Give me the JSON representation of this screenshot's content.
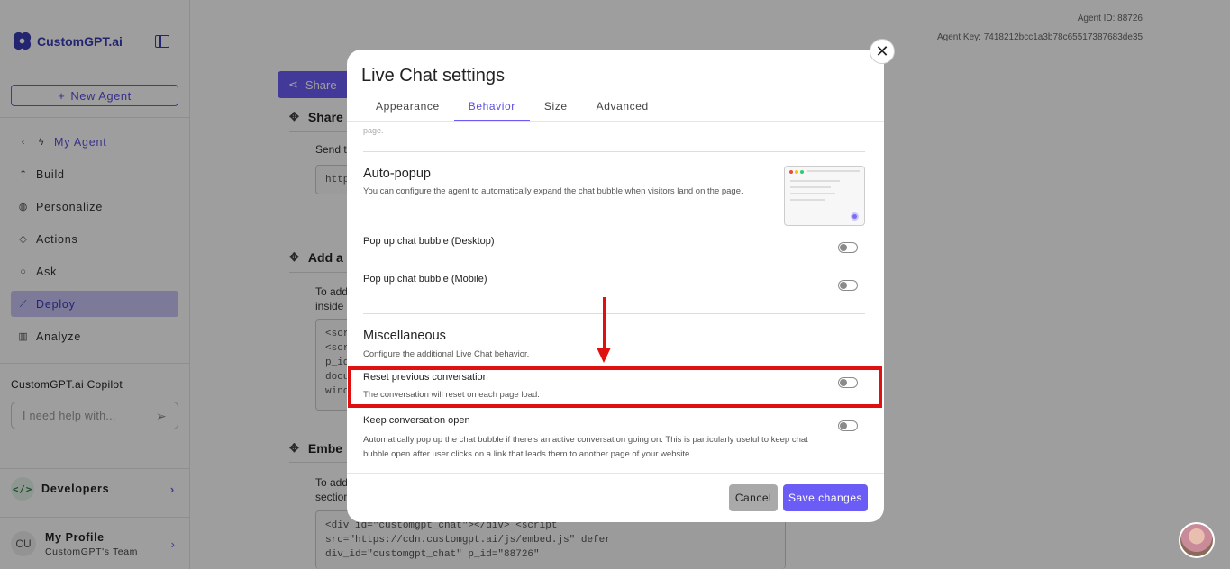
{
  "sidebar": {
    "logo_text": "CustomGPT.ai",
    "new_agent_label": "New Agent",
    "back_label": "My Agent",
    "items": [
      {
        "label": "Build",
        "icon": "build-icon"
      },
      {
        "label": "Personalize",
        "icon": "palette-icon"
      },
      {
        "label": "Actions",
        "icon": "actions-icon"
      },
      {
        "label": "Ask",
        "icon": "chat-icon"
      },
      {
        "label": "Deploy",
        "icon": "rocket-icon",
        "active": true
      },
      {
        "label": "Analyze",
        "icon": "chart-icon"
      }
    ],
    "copilot_title": "CustomGPT.ai Copilot",
    "copilot_placeholder": "I need help with...",
    "developers_label": "Developers",
    "profile_initials": "CU",
    "profile_name": "My Profile",
    "profile_team": "CustomGPT's Team"
  },
  "main": {
    "agent_id": "Agent ID: 88726",
    "agent_key": "Agent Key: 7418212bcc1a3b78c65517387683de35",
    "share_button": "Share",
    "section1_title": "Share",
    "section1_text": "Send t",
    "section1_box": "http",
    "section2_title": "Add a",
    "section2_text_1": "To add",
    "section2_text_2": "inside",
    "section2_box_lines": [
      "<scri",
      "<scri",
      "p_id",
      "docu",
      "wind"
    ],
    "section3_title": "Embe",
    "section3_text_1": "To add",
    "section3_text_2": "section",
    "section3_box_lines": [
      "<div id=\"customgpt_chat\"></div> <script",
      "src=\"https://cdn.customgpt.ai/js/embed.js\" defer",
      "div_id=\"customgpt_chat\" p_id=\"88726\""
    ]
  },
  "modal": {
    "title": "Live Chat settings",
    "tabs": [
      {
        "label": "Appearance",
        "active": false
      },
      {
        "label": "Behavior",
        "active": true
      },
      {
        "label": "Size",
        "active": false
      },
      {
        "label": "Advanced",
        "active": false
      }
    ],
    "faded_text": "page.",
    "auto_popup": {
      "heading": "Auto-popup",
      "description": "You can configure the agent to automatically expand the chat bubble when visitors land on the page.",
      "desktop_label": "Pop up chat bubble (Desktop)",
      "mobile_label": "Pop up chat bubble (Mobile)",
      "desktop_on": false,
      "mobile_on": false
    },
    "misc": {
      "heading": "Miscellaneous",
      "description": "Configure the additional Live Chat behavior.",
      "reset_label": "Reset previous conversation",
      "reset_desc": "The conversation will reset on each page load.",
      "reset_on": false,
      "keep_label": "Keep conversation open",
      "keep_desc_1": "Automatically pop up the chat bubble if there's an active conversation going on. This is particularly useful to keep chat",
      "keep_desc_2": "bubble open after user clicks on a link that leads them to another page of your website.",
      "keep_on": false
    },
    "cancel_label": "Cancel",
    "save_label": "Save changes"
  },
  "colors": {
    "accent": "#6b5cf6",
    "annotation": "#e01010"
  }
}
